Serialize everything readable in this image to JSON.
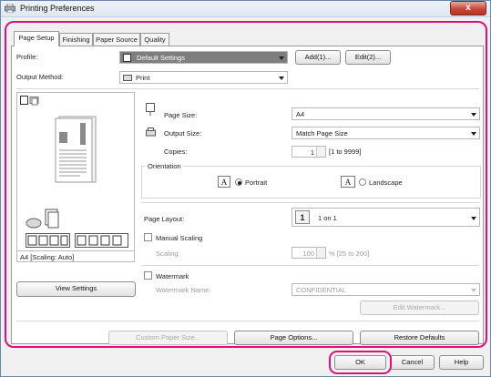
{
  "window": {
    "title": "Printing Preferences",
    "close_glyph": "x"
  },
  "tabs": [
    {
      "label": "Page Setup",
      "active": true
    },
    {
      "label": "Finishing",
      "active": false
    },
    {
      "label": "Paper Source",
      "active": false
    },
    {
      "label": "Quality",
      "active": false
    }
  ],
  "profile": {
    "label": "Profile:",
    "value": "Default Settings",
    "add_label": "Add(1)...",
    "edit_label": "Edit(2)..."
  },
  "output_method": {
    "label": "Output Method:",
    "value": "Print"
  },
  "page_size": {
    "label": "Page Size:",
    "value": "A4"
  },
  "output_size": {
    "label": "Output Size:",
    "value": "Match Page Size"
  },
  "copies": {
    "label": "Copies:",
    "value": "1",
    "range": "[1 to 9999]"
  },
  "orientation": {
    "label": "Orientation",
    "portrait_label": "Portrait",
    "landscape_label": "Landscape",
    "portrait_icon_glyph": "A",
    "landscape_icon_glyph": "A",
    "selected": "Portrait"
  },
  "page_layout": {
    "label": "Page Layout:",
    "value_number": "1",
    "value": "1 on 1"
  },
  "manual_scaling": {
    "label": "Manual Scaling",
    "checked": false,
    "scaling_label": "Scaling:",
    "scaling_value": "100",
    "scaling_range": "% [25 to 200]"
  },
  "watermark": {
    "label": "Watermark",
    "checked": false,
    "name_label": "Watermark Name:",
    "name_value": "CONFIDENTIAL",
    "edit_label": "Edit Watermark..."
  },
  "preview": {
    "status": "A4 [Scaling: Auto]",
    "view_settings_label": "View Settings"
  },
  "bottom_buttons": {
    "custom_paper_size": "Custom Paper Size...",
    "page_options": "Page Options...",
    "restore_defaults": "Restore Defaults"
  },
  "dialog_buttons": {
    "ok": "OK",
    "cancel": "Cancel",
    "help": "Help"
  },
  "colors": {
    "highlight": "#e0107a",
    "close_button": "#c9483a",
    "profile_selected": "#7e7e7e"
  }
}
